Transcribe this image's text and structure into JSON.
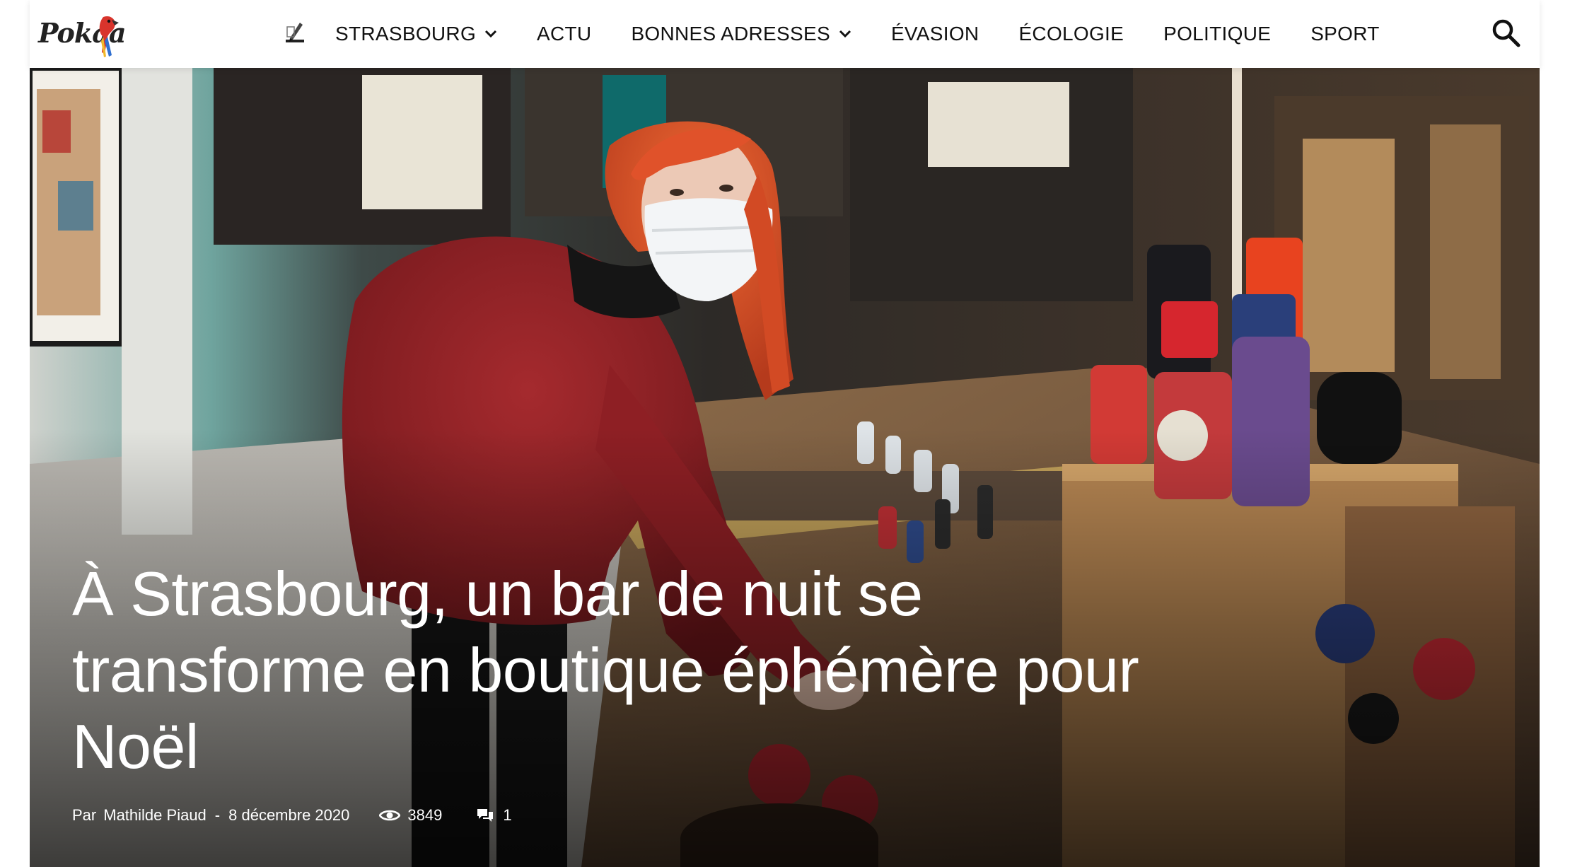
{
  "header": {
    "logo_text": "Pokaa",
    "nav": [
      {
        "label": "STRASBOURG",
        "has_dropdown": true
      },
      {
        "label": "ACTU",
        "has_dropdown": false
      },
      {
        "label": "BONNES ADRESSES",
        "has_dropdown": true
      },
      {
        "label": "ÉVASION",
        "has_dropdown": false
      },
      {
        "label": "ÉCOLOGIE",
        "has_dropdown": false
      },
      {
        "label": "POLITIQUE",
        "has_dropdown": false
      },
      {
        "label": "SPORT",
        "has_dropdown": false
      }
    ],
    "home_icon": "home-writing-icon",
    "search_icon": "search-icon"
  },
  "article": {
    "headline": "À Strasbourg, un bar de nuit se transforme en boutique éphémère pour Noël",
    "by_label": "Par",
    "author": "Mathilde Piaud",
    "separator": "-",
    "date": "8 décembre 2020",
    "views": "3849",
    "comments": "1",
    "views_icon": "eye-icon",
    "comments_icon": "comment-icon"
  },
  "colors": {
    "header_bg": "#ffffff",
    "nav_text": "#111111",
    "headline_text": "#ffffff",
    "sweater_red": "#8e1f24",
    "hair_orange": "#e0522a",
    "wood": "#8a6340",
    "table_top": "#5c4330"
  }
}
